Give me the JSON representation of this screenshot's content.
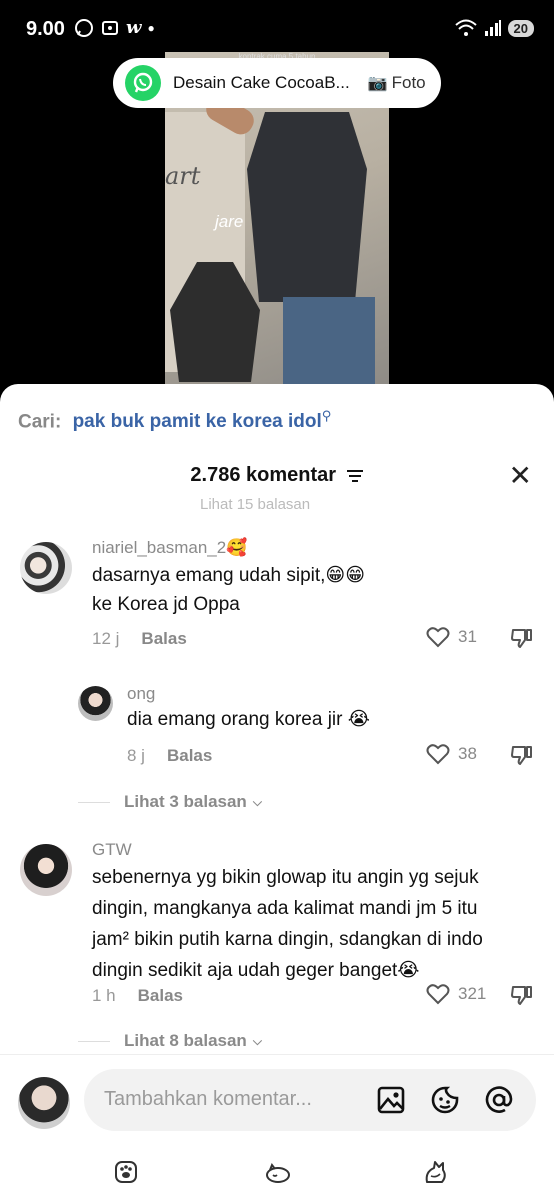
{
  "status_bar": {
    "time": "9.00",
    "battery": "20",
    "wifi_sub": "5",
    "app_icon_letter": "w"
  },
  "notification": {
    "title": "Desain Cake CocoaB...",
    "attachment": "Foto"
  },
  "video": {
    "caption": "jare",
    "wall_text": "art",
    "top_text": "kontrak cuma 5 tahun"
  },
  "search": {
    "label": "Cari:",
    "query": "pak buk pamit ke korea idol"
  },
  "header": {
    "count_label": "2.786 komentar"
  },
  "hidden_previous": "Lihat 15 balasan",
  "comments": [
    {
      "username": "niariel_basman_2🥰",
      "text_line1": "dasarnya emang udah sipit,😁😁",
      "text_line2": "ke Korea jd Oppa",
      "time": "12 j",
      "reply": "Balas",
      "likes": "31"
    },
    {
      "username": "ong",
      "text": "dia emang orang korea jir 😭",
      "time": "8 j",
      "reply": "Balas",
      "likes": "38"
    },
    {
      "username": "GTW",
      "text_line1": "sebenernya yg bikin glowap itu angin yg sejuk",
      "text_line2": "dingin, mangkanya ada kalimat mandi jm 5 itu",
      "text_line3": "jam² bikin putih karna dingin, sdangkan di indo",
      "text_line4": "dingin sedikit aja udah geger banget😭",
      "time": "1 h",
      "reply": "Balas",
      "likes": "321"
    }
  ],
  "more_replies": [
    "Lihat 3 balasan",
    "Lihat 8 balasan"
  ],
  "input": {
    "placeholder": "Tambahkan komentar..."
  },
  "colors": {
    "link": "#3a64a6",
    "whatsapp": "#25d366",
    "muted": "#8a8a8a"
  }
}
